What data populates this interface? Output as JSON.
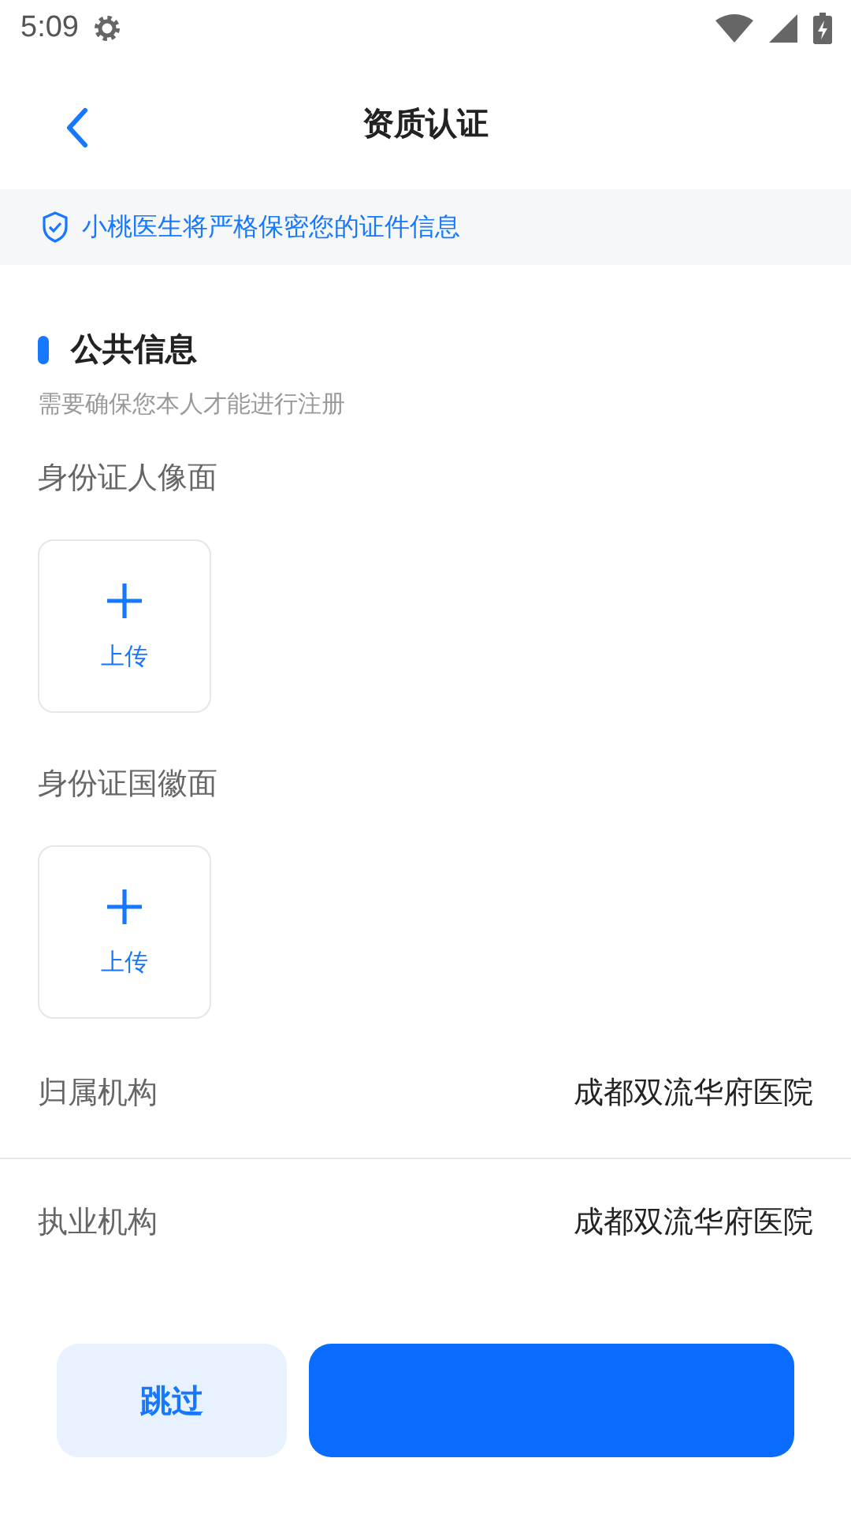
{
  "status_bar": {
    "time": "5:09"
  },
  "header": {
    "title": "资质认证"
  },
  "notice": {
    "text": "小桃医生将严格保密您的证件信息"
  },
  "section": {
    "title": "公共信息",
    "subtitle": "需要确保您本人才能进行注册"
  },
  "uploads": [
    {
      "label": "身份证人像面",
      "button": "上传"
    },
    {
      "label": "身份证国徽面",
      "button": "上传"
    }
  ],
  "fields": [
    {
      "label": "归属机构",
      "value": "成都双流华府医院"
    },
    {
      "label": "执业机构",
      "value": "成都双流华府医院"
    }
  ],
  "buttons": {
    "skip": "跳过"
  }
}
